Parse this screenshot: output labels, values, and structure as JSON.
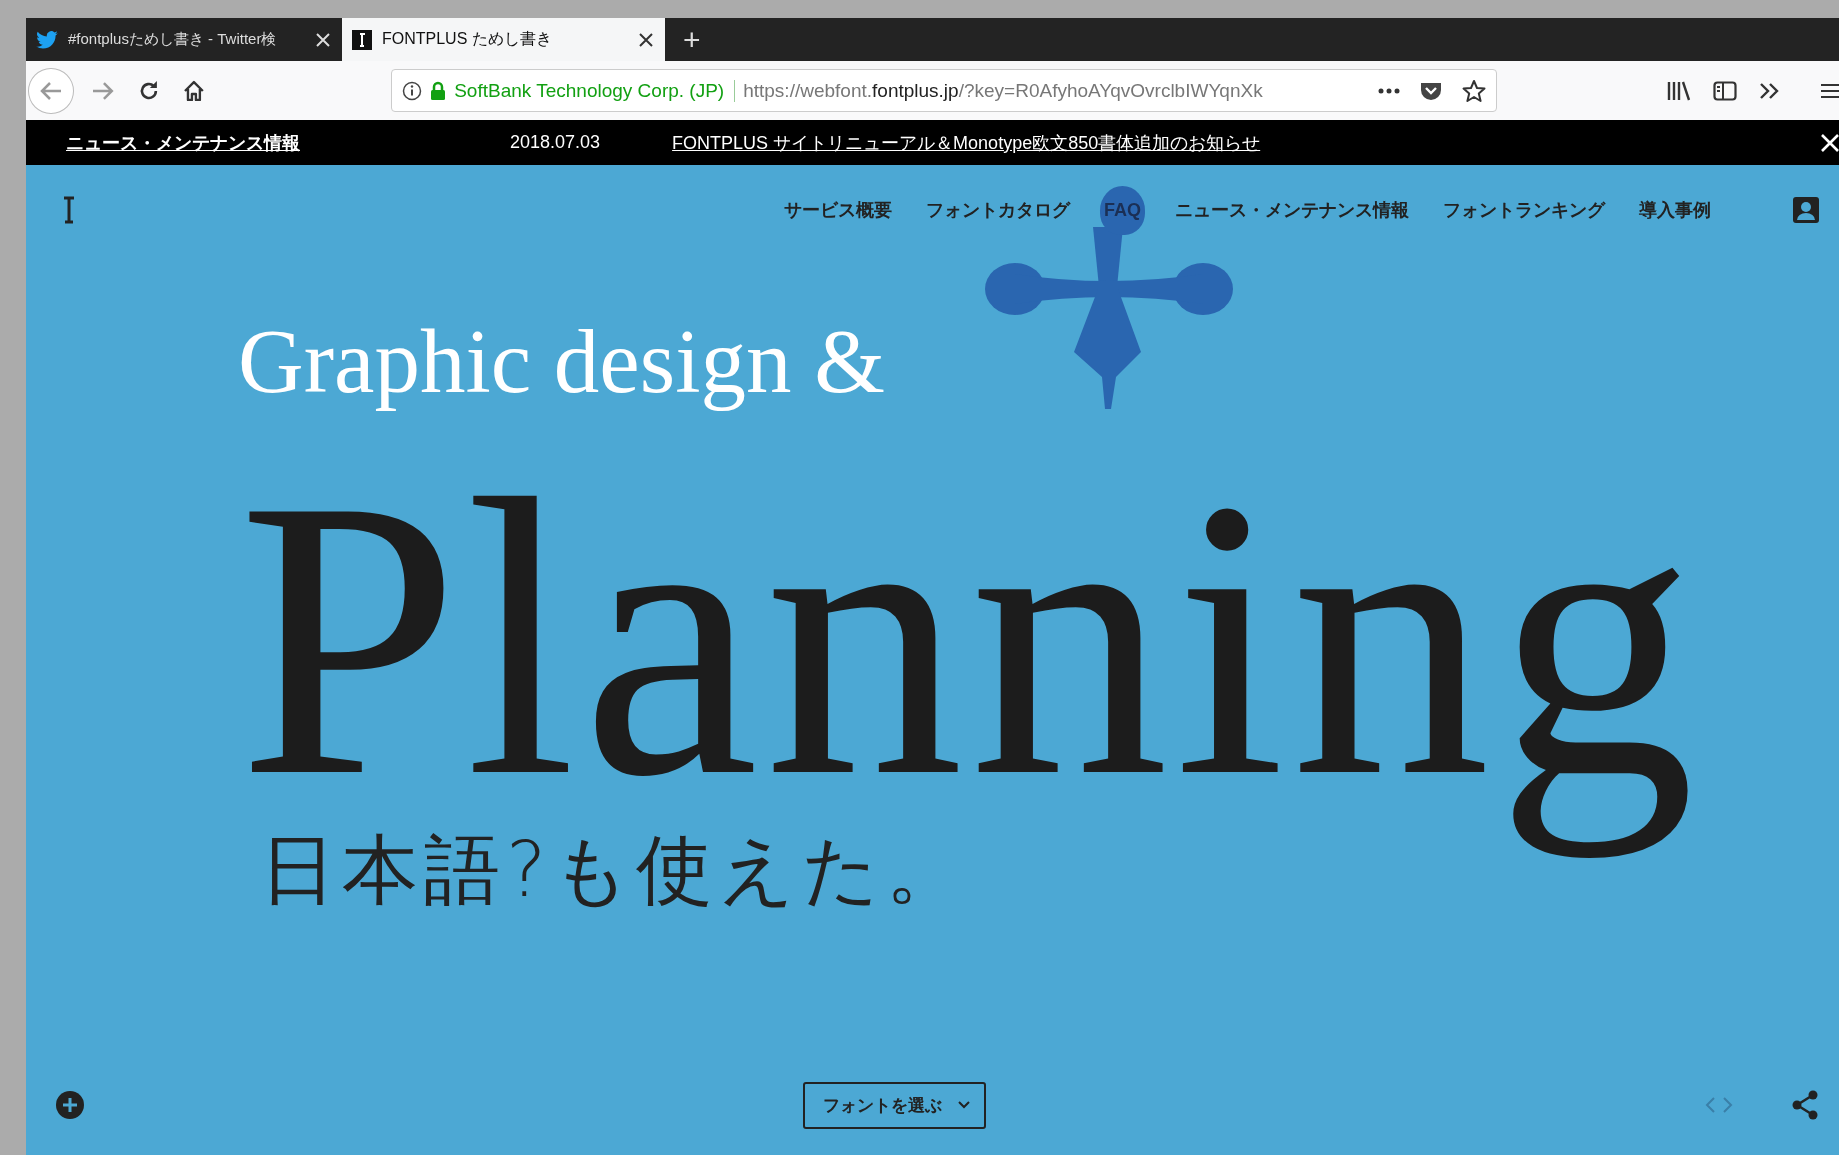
{
  "browser": {
    "tabs": [
      {
        "kind": "twitter",
        "title": "#fontplusためし書き - Twitter検",
        "selected": false
      },
      {
        "kind": "fontplus",
        "title": "FONTPLUS ためし書き",
        "selected": true
      }
    ],
    "new_tab": "+",
    "identity": "SoftBank Technology Corp. (JP)",
    "url_scheme": "https://webfont.",
    "url_host": "fontplus.jp",
    "url_path": "/?key=R0AfyhoAYqvOvrclbIWYqnXk"
  },
  "news_bar": {
    "label": "ニュース・メンテナンス情報",
    "date": "2018.07.03",
    "headline": "FONTPLUS サイトリニューアル＆Monotype欧文850書体追加のお知らせ"
  },
  "nav": {
    "items": [
      {
        "label": "サービス概要",
        "selected": false
      },
      {
        "label": "フォントカタログ",
        "selected": false
      },
      {
        "label": "FAQ",
        "selected": true
      },
      {
        "label": "ニュース・メンテナンス情報",
        "selected": false
      },
      {
        "label": "フォントランキング",
        "selected": false
      },
      {
        "label": "導入事例",
        "selected": false
      }
    ]
  },
  "hero": {
    "subtitle": "Graphic design &",
    "title": "Planning",
    "japanese": "日本語?も使えた。"
  },
  "footer": {
    "select_button": "フォントを選ぶ"
  }
}
